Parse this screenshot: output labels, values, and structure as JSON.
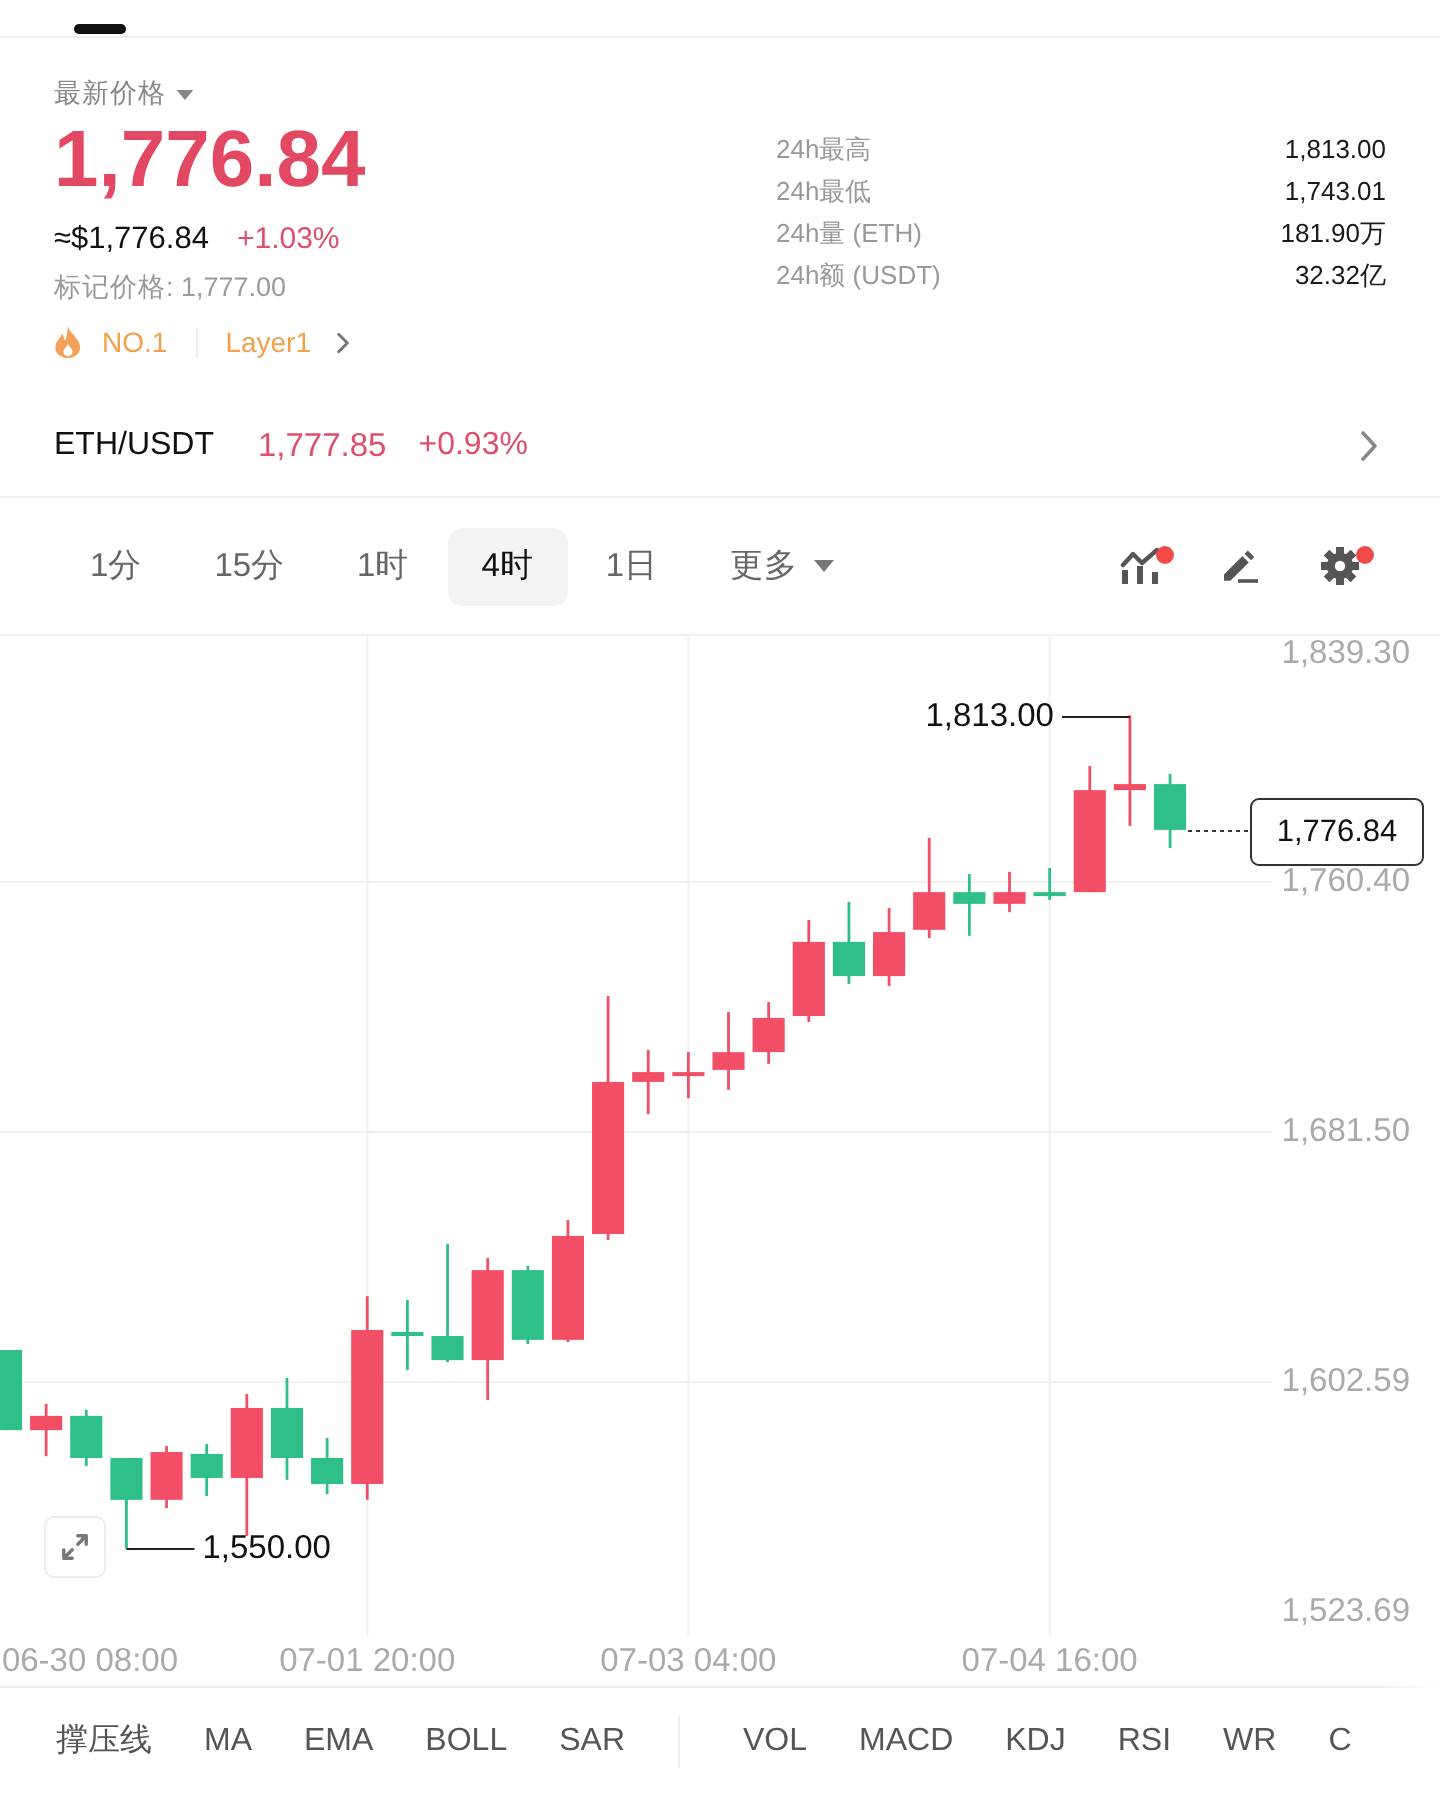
{
  "header": {
    "price_label": "最新价格",
    "price": "1,776.84",
    "usd_price": "≈$1,776.84",
    "change": "+1.03%",
    "mark_price": "标记价格: 1,777.00",
    "rank": "NO.1",
    "sector": "Layer1"
  },
  "stats": [
    {
      "label": "24h最高",
      "value": "1,813.00"
    },
    {
      "label": "24h最低",
      "value": "1,743.01"
    },
    {
      "label": "24h量 (ETH)",
      "value": "181.90万"
    },
    {
      "label": "24h额 (USDT)",
      "value": "32.32亿"
    }
  ],
  "pair": {
    "symbol": "ETH/USDT",
    "price": "1,777.85",
    "change": "+0.93%"
  },
  "intervals": [
    {
      "label": "1分",
      "kind": "interval",
      "selected": false
    },
    {
      "label": "15分",
      "kind": "interval",
      "selected": false
    },
    {
      "label": "1时",
      "kind": "interval",
      "selected": false
    },
    {
      "label": "4时",
      "kind": "interval",
      "selected": true
    },
    {
      "label": "1日",
      "kind": "interval",
      "selected": false
    },
    {
      "label": "更多",
      "kind": "menu",
      "selected": false
    }
  ],
  "tools": [
    {
      "kind": "indicators",
      "dot": true
    },
    {
      "kind": "draw",
      "dot": false
    },
    {
      "kind": "settings",
      "dot": true
    }
  ],
  "chart": {
    "chart_data": {
      "type": "candlestick",
      "categories": [
        null,
        null,
        "06-30 08:00",
        null,
        null,
        null,
        null,
        null,
        null,
        "07-01 20:00",
        null,
        null,
        null,
        null,
        null,
        null,
        null,
        "07-03 04:00",
        null,
        null,
        null,
        null,
        null,
        null,
        null,
        null,
        "07-04 16:00",
        null,
        null,
        null
      ],
      "ohlc": [
        [
          1612.7,
          1612.7,
          1587.4,
          1587.4
        ],
        [
          1587.4,
          1595.7,
          1579.2,
          1591.9
        ],
        [
          1591.9,
          1593.8,
          1576.1,
          1578.6
        ],
        [
          1578.6,
          1578.6,
          1550.0,
          1565.4
        ],
        [
          1565.4,
          1582.4,
          1562.8,
          1580.5
        ],
        [
          1579.9,
          1583.0,
          1566.6,
          1572.3
        ],
        [
          1572.3,
          1598.8,
          1554.0,
          1594.4
        ],
        [
          1594.4,
          1603.9,
          1571.7,
          1578.6
        ],
        [
          1578.6,
          1584.9,
          1567.2,
          1570.4
        ],
        [
          1570.4,
          1629.7,
          1565.4,
          1619.0
        ],
        [
          1618.4,
          1628.5,
          1606.4,
          1617.1
        ],
        [
          1617.1,
          1646.2,
          1608.9,
          1609.5
        ],
        [
          1609.5,
          1641.7,
          1596.9,
          1637.9
        ],
        [
          1637.9,
          1639.2,
          1614.6,
          1615.9
        ],
        [
          1615.9,
          1653.7,
          1615.2,
          1648.7
        ],
        [
          1649.3,
          1724.4,
          1647.4,
          1697.3
        ],
        [
          1697.3,
          1707.4,
          1687.2,
          1700.4
        ],
        [
          1699.2,
          1706.7,
          1692.2,
          1700.4
        ],
        [
          1701.1,
          1719.4,
          1694.8,
          1706.7
        ],
        [
          1706.7,
          1722.5,
          1703.0,
          1717.5
        ],
        [
          1718.1,
          1748.4,
          1716.2,
          1741.5
        ],
        [
          1741.5,
          1754.1,
          1728.2,
          1730.7
        ],
        [
          1730.7,
          1752.2,
          1727.6,
          1744.6
        ],
        [
          1745.3,
          1774.3,
          1742.7,
          1757.2
        ],
        [
          1757.2,
          1762.9,
          1743.4,
          1753.5
        ],
        [
          1753.5,
          1763.6,
          1750.9,
          1757.2
        ],
        [
          1757.2,
          1764.8,
          1754.7,
          1756.0
        ],
        [
          1757.2,
          1797.0,
          1757.2,
          1789.4
        ],
        [
          1789.4,
          1813.0,
          1778.1,
          1791.3
        ],
        [
          1791.3,
          1794.5,
          1771.1,
          1776.84
        ]
      ],
      "ylim": [
        1523.69,
        1839.3
      ],
      "yticks": [
        {
          "value": 1839.3,
          "label": "1,839.30"
        },
        {
          "value": 1760.4,
          "label": "1,760.40"
        },
        {
          "value": 1681.5,
          "label": "1,681.50"
        },
        {
          "value": 1602.59,
          "label": "1,602.59"
        },
        {
          "value": 1523.69,
          "label": "1,523.69"
        }
      ],
      "grid": true
    },
    "high_label": "1,813.00",
    "low_label": "1,550.00",
    "last_price": "1,776.84"
  },
  "main_indicators": [
    "撑压线",
    "MA",
    "EMA",
    "BOLL",
    "SAR"
  ],
  "sub_indicators": [
    "VOL",
    "MACD",
    "KDJ",
    "RSI",
    "WR",
    "C"
  ]
}
